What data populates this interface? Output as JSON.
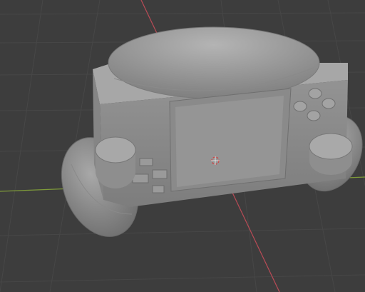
{
  "viewport": {
    "background": "#3d3d3d",
    "grid_color": "#4a4a4a",
    "axis_x_color": "#b94b56",
    "axis_y_color": "#7e9a3a"
  },
  "scene": {
    "object_color": "#9b9b9b",
    "cursor_icon": "3d-cursor-icon"
  }
}
